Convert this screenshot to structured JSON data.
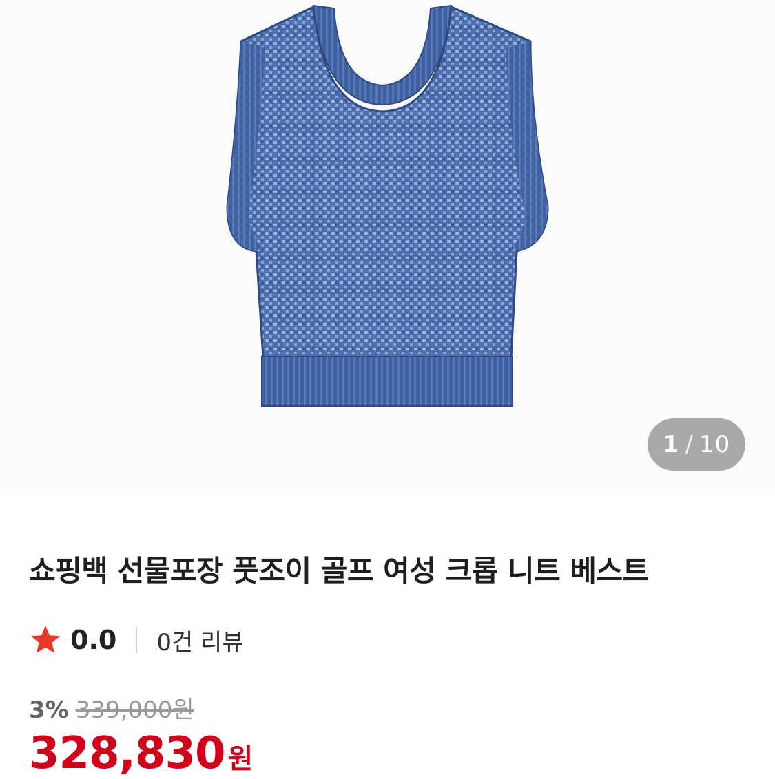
{
  "product": {
    "image_alt": "knit vest product image",
    "image_counter": {
      "current": "1",
      "separator": "/",
      "total": "10"
    },
    "title": "쇼핑백 선물포장 풋조이 골프 여성 크롭 니트 베스트"
  },
  "rating": {
    "icon": "star-icon",
    "score": "0.0",
    "reviews": "0건 리뷰"
  },
  "pricing": {
    "discount": "3%",
    "original_price": "339,000원",
    "sale_price": "328,830",
    "currency": "원"
  },
  "colors": {
    "accent_red": "#d0021b",
    "star": "#e8382b",
    "vest_blue": "#4a6fb0"
  }
}
